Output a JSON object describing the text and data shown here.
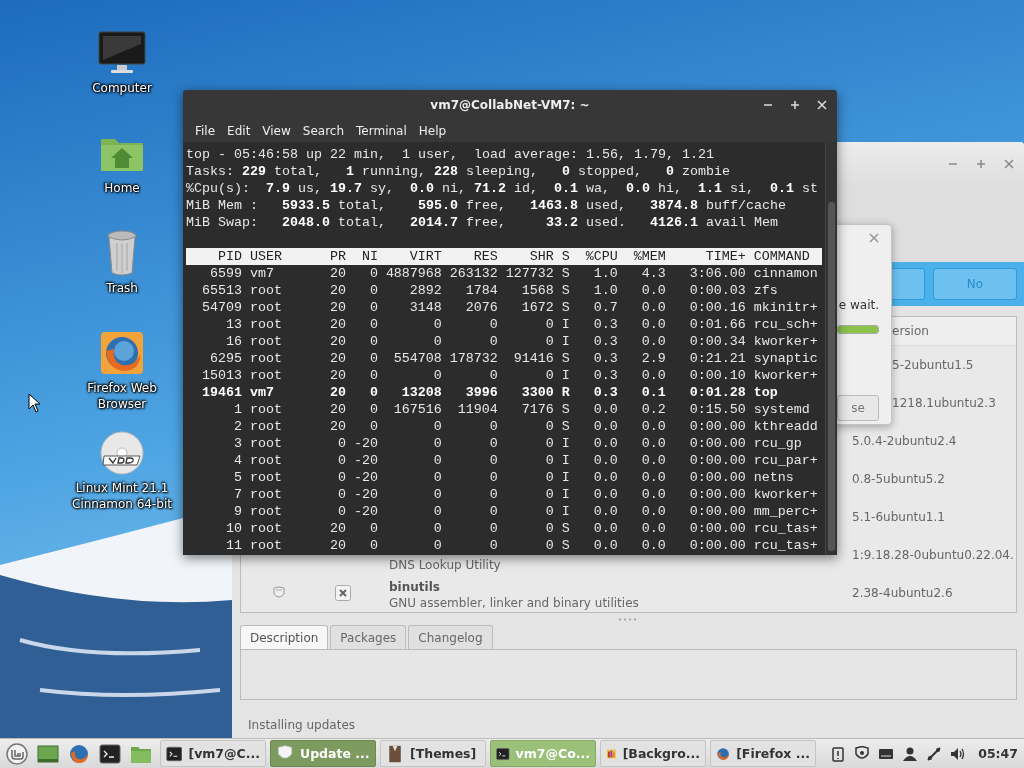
{
  "desktop_icons": [
    {
      "label": "Computer",
      "kind": "computer"
    },
    {
      "label": "Home",
      "kind": "home"
    },
    {
      "label": "Trash",
      "kind": "trash"
    },
    {
      "label": "Firefox Web Browser",
      "kind": "firefox"
    },
    {
      "label": "Linux Mint 21.1 Cinnamon 64-bit",
      "kind": "dvd"
    }
  ],
  "update_manager": {
    "buttons": [
      "No"
    ],
    "version_header": "ersion",
    "packages": [
      {
        "version": "5-2ubuntu1.5"
      },
      {
        "version": "1218.1ubuntu2.3"
      },
      {
        "version": "5.0.4-2ubuntu2.4"
      },
      {
        "version": "0.8-5ubuntu5.2"
      },
      {
        "version": "5.1-6ubuntu1.1"
      },
      {
        "description": "DNS Lookup Utility",
        "version": "1:9.18.28-0ubuntu0.22.04."
      },
      {
        "name": "binutils",
        "description": "GNU assembler, linker and binary utilities",
        "version": "2.38-4ubuntu2.6",
        "checked": true
      }
    ],
    "tabs": [
      {
        "label": "Description",
        "selected": true
      },
      {
        "label": "Packages",
        "selected": false
      },
      {
        "label": "Changelog",
        "selected": false
      }
    ],
    "status": "Installing updates"
  },
  "progress_dialog": {
    "message": "e wait.",
    "level": 1,
    "button": "se"
  },
  "terminal": {
    "title": "vm7@CollabNet-VM7: ~",
    "menu": [
      "File",
      "Edit",
      "View",
      "Search",
      "Terminal",
      "Help"
    ],
    "summary": [
      "top - 05:46:58 up 22 min,  1 user,  load average: 1.56, 1.79, 1.21",
      "Tasks: **229** total,   **1** running, **228** sleeping,   **0** stopped,   **0** zombie",
      "%Cpu(s):  **7.9** us, **19.7** sy,  **0.0** ni, **71.2** id,  **0.1** wa,  **0.0** hi,  **1.1** si,  **0.1** st",
      "MiB Mem :   **5933.5** total,    **595.0** free,   **1463.8** used,   **3874.8** buff/cache",
      "MiB Swap:   **2048.0** total,   **2014.7** free,     **33.2** used.   **4126.1** avail Mem"
    ],
    "columns": [
      "PID",
      "USER",
      "PR",
      "NI",
      "VIRT",
      "RES",
      "SHR",
      "S",
      "%CPU",
      "%MEM",
      "TIME+",
      "COMMAND"
    ],
    "rows": [
      {
        "cells": [
          "6599",
          "vm7",
          "20",
          "0",
          "4887968",
          "263132",
          "127732",
          "S",
          "1.0",
          "4.3",
          "3:06.00",
          "cinnamon"
        ],
        "highlighted": false
      },
      {
        "cells": [
          "65513",
          "root",
          "20",
          "0",
          "2892",
          "1784",
          "1568",
          "S",
          "1.0",
          "0.0",
          "0:00.03",
          "zfs"
        ],
        "highlighted": false
      },
      {
        "cells": [
          "54709",
          "root",
          "20",
          "0",
          "3148",
          "2076",
          "1672",
          "S",
          "0.7",
          "0.0",
          "0:00.16",
          "mkinitr+"
        ],
        "highlighted": false
      },
      {
        "cells": [
          "13",
          "root",
          "20",
          "0",
          "0",
          "0",
          "0",
          "I",
          "0.3",
          "0.0",
          "0:01.66",
          "rcu_sch+"
        ],
        "highlighted": false
      },
      {
        "cells": [
          "16",
          "root",
          "20",
          "0",
          "0",
          "0",
          "0",
          "I",
          "0.3",
          "0.0",
          "0:00.34",
          "kworker+"
        ],
        "highlighted": false
      },
      {
        "cells": [
          "6295",
          "root",
          "20",
          "0",
          "554708",
          "178732",
          "91416",
          "S",
          "0.3",
          "2.9",
          "0:21.21",
          "synaptic"
        ],
        "highlighted": false
      },
      {
        "cells": [
          "15013",
          "root",
          "20",
          "0",
          "0",
          "0",
          "0",
          "I",
          "0.3",
          "0.0",
          "0:00.10",
          "kworker+"
        ],
        "highlighted": false
      },
      {
        "cells": [
          "19461",
          "vm7",
          "20",
          "0",
          "13208",
          "3996",
          "3300",
          "R",
          "0.3",
          "0.1",
          "0:01.28",
          "top"
        ],
        "highlighted": true
      },
      {
        "cells": [
          "1",
          "root",
          "20",
          "0",
          "167516",
          "11904",
          "7176",
          "S",
          "0.0",
          "0.2",
          "0:15.50",
          "systemd"
        ],
        "highlighted": false
      },
      {
        "cells": [
          "2",
          "root",
          "20",
          "0",
          "0",
          "0",
          "0",
          "S",
          "0.0",
          "0.0",
          "0:00.00",
          "kthreadd"
        ],
        "highlighted": false
      },
      {
        "cells": [
          "3",
          "root",
          "0",
          "-20",
          "0",
          "0",
          "0",
          "I",
          "0.0",
          "0.0",
          "0:00.00",
          "rcu_gp"
        ],
        "highlighted": false
      },
      {
        "cells": [
          "4",
          "root",
          "0",
          "-20",
          "0",
          "0",
          "0",
          "I",
          "0.0",
          "0.0",
          "0:00.00",
          "rcu_par+"
        ],
        "highlighted": false
      },
      {
        "cells": [
          "5",
          "root",
          "0",
          "-20",
          "0",
          "0",
          "0",
          "I",
          "0.0",
          "0.0",
          "0:00.00",
          "netns"
        ],
        "highlighted": false
      },
      {
        "cells": [
          "7",
          "root",
          "0",
          "-20",
          "0",
          "0",
          "0",
          "I",
          "0.0",
          "0.0",
          "0:00.00",
          "kworker+"
        ],
        "highlighted": false
      },
      {
        "cells": [
          "9",
          "root",
          "0",
          "-20",
          "0",
          "0",
          "0",
          "I",
          "0.0",
          "0.0",
          "0:00.00",
          "mm_perc+"
        ],
        "highlighted": false
      },
      {
        "cells": [
          "10",
          "root",
          "20",
          "0",
          "0",
          "0",
          "0",
          "S",
          "0.0",
          "0.0",
          "0:00.00",
          "rcu_tas+"
        ],
        "highlighted": false
      },
      {
        "cells": [
          "11",
          "root",
          "20",
          "0",
          "0",
          "0",
          "0",
          "S",
          "0.0",
          "0.0",
          "0:00.00",
          "rcu_tas+"
        ],
        "highlighted": false
      }
    ]
  },
  "taskbar": {
    "launchers": [
      {
        "kind": "mint"
      },
      {
        "kind": "desktop"
      },
      {
        "kind": "firefox"
      },
      {
        "kind": "terminal"
      },
      {
        "kind": "folder"
      }
    ],
    "windows": [
      {
        "label": "[vm7@C...",
        "kind": "terminal",
        "focused": false,
        "attention": false
      },
      {
        "label": "Update ...",
        "kind": "shield",
        "focused": false,
        "attention": true
      },
      {
        "label": "[Themes]",
        "kind": "themes",
        "focused": false,
        "attention": false
      },
      {
        "label": "vm7@Co...",
        "kind": "terminal",
        "focused": true,
        "attention": false
      },
      {
        "label": "[Backgro...",
        "kind": "backgrounds",
        "focused": false,
        "attention": false
      },
      {
        "label": "[Firefox ...",
        "kind": "firefox",
        "focused": false,
        "attention": false
      }
    ],
    "tray": [
      {
        "kind": "clipboard"
      },
      {
        "kind": "shield"
      },
      {
        "kind": "keyboard"
      },
      {
        "kind": "user"
      },
      {
        "kind": "network"
      },
      {
        "kind": "volume"
      }
    ],
    "clock": "05:47"
  }
}
